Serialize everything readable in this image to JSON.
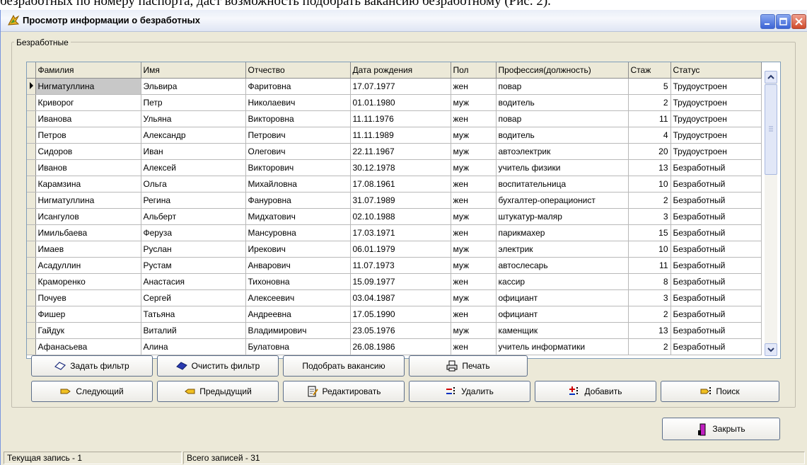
{
  "document_text": "безработных по номеру паспорта, даст возможность подобрать вакансию безработному (Рис. 2).",
  "window": {
    "title": "Просмотр информации о безработных"
  },
  "group_label": "Безработные",
  "table": {
    "columns": [
      "Фамилия",
      "Имя",
      "Отчество",
      "Дата рождения",
      "Пол",
      "Профессия(должность)",
      "Стаж",
      "Статус"
    ],
    "rows": [
      [
        "Нигматуллина",
        "Эльвира",
        "Фаритовна",
        "17.07.1977",
        "жен",
        "повар",
        "5",
        "Трудоустроен"
      ],
      [
        "Криворог",
        "Петр",
        "Николаевич",
        "01.01.1980",
        "муж",
        "водитель",
        "2",
        "Трудоустроен"
      ],
      [
        "Иванова",
        "Ульяна",
        "Викторовна",
        "11.11.1976",
        "жен",
        "повар",
        "11",
        "Трудоустроен"
      ],
      [
        "Петров",
        "Александр",
        "Петрович",
        "11.11.1989",
        "муж",
        "водитель",
        "4",
        "Трудоустроен"
      ],
      [
        "Сидоров",
        "Иван",
        "Олегович",
        "22.11.1967",
        "муж",
        "автоэлектрик",
        "20",
        "Трудоустроен"
      ],
      [
        "Иванов",
        "Алексей",
        "Викторович",
        "30.12.1978",
        "муж",
        "учитель физики",
        "13",
        "Безработный"
      ],
      [
        "Карамзина",
        "Ольга",
        "Михайловна",
        "17.08.1961",
        "жен",
        "воспитательница",
        "10",
        "Безработный"
      ],
      [
        "Нигматуллина",
        "Регина",
        "Фануровна",
        "31.07.1989",
        "жен",
        "бухгалтер-операционист",
        "2",
        "Безработный"
      ],
      [
        "Исангулов",
        "Альберт",
        "Мидхатович",
        "02.10.1988",
        "муж",
        "штукатур-маляр",
        "3",
        "Безработный"
      ],
      [
        "Имильбаева",
        "Феруза",
        "Мансуровна",
        "17.03.1971",
        "жен",
        "парикмахер",
        "15",
        "Безработный"
      ],
      [
        "Имаев",
        "Руслан",
        "Ирекович",
        "06.01.1979",
        "муж",
        "электрик",
        "10",
        "Безработный"
      ],
      [
        "Асадуллин",
        "Рустам",
        "Анварович",
        "11.07.1973",
        "муж",
        "автослесарь",
        "11",
        "Безработный"
      ],
      [
        "Краморенко",
        "Анастасия",
        "Тихоновна",
        "15.09.1977",
        "жен",
        "кассир",
        "8",
        "Безработный"
      ],
      [
        "Почуев",
        "Сергей",
        "Алексеевич",
        "03.04.1987",
        "муж",
        "официант",
        "3",
        "Безработный"
      ],
      [
        "Фишер",
        "Татьяна",
        "Андреевна",
        "17.05.1990",
        "жен",
        "официант",
        "2",
        "Безработный"
      ],
      [
        "Гайдук",
        "Виталий",
        "Владимирович",
        "23.05.1976",
        "муж",
        "каменщик",
        "13",
        "Безработный"
      ],
      [
        "Афанасьева",
        "Алина",
        "Булатовна",
        "26.08.1986",
        "жен",
        "учитель информатики",
        "2",
        "Безработный"
      ]
    ]
  },
  "buttons": {
    "set_filter": "Задать фильтр",
    "clear_filter": "Очистить фильтр",
    "find_vacancy": "Подобрать вакансию",
    "print": "Печать",
    "next": "Следующий",
    "prev": "Предыдущий",
    "edit": "Редактировать",
    "delete": "Удалить",
    "add": "Добавить",
    "search": "Поиск",
    "close": "Закрыть"
  },
  "status": {
    "current_record": "Текущая запись - 1",
    "total_records": "Всего записей - 31"
  },
  "colors": {
    "selected_cell": "#c8c8c8",
    "window_bg": "#ece9d8"
  }
}
